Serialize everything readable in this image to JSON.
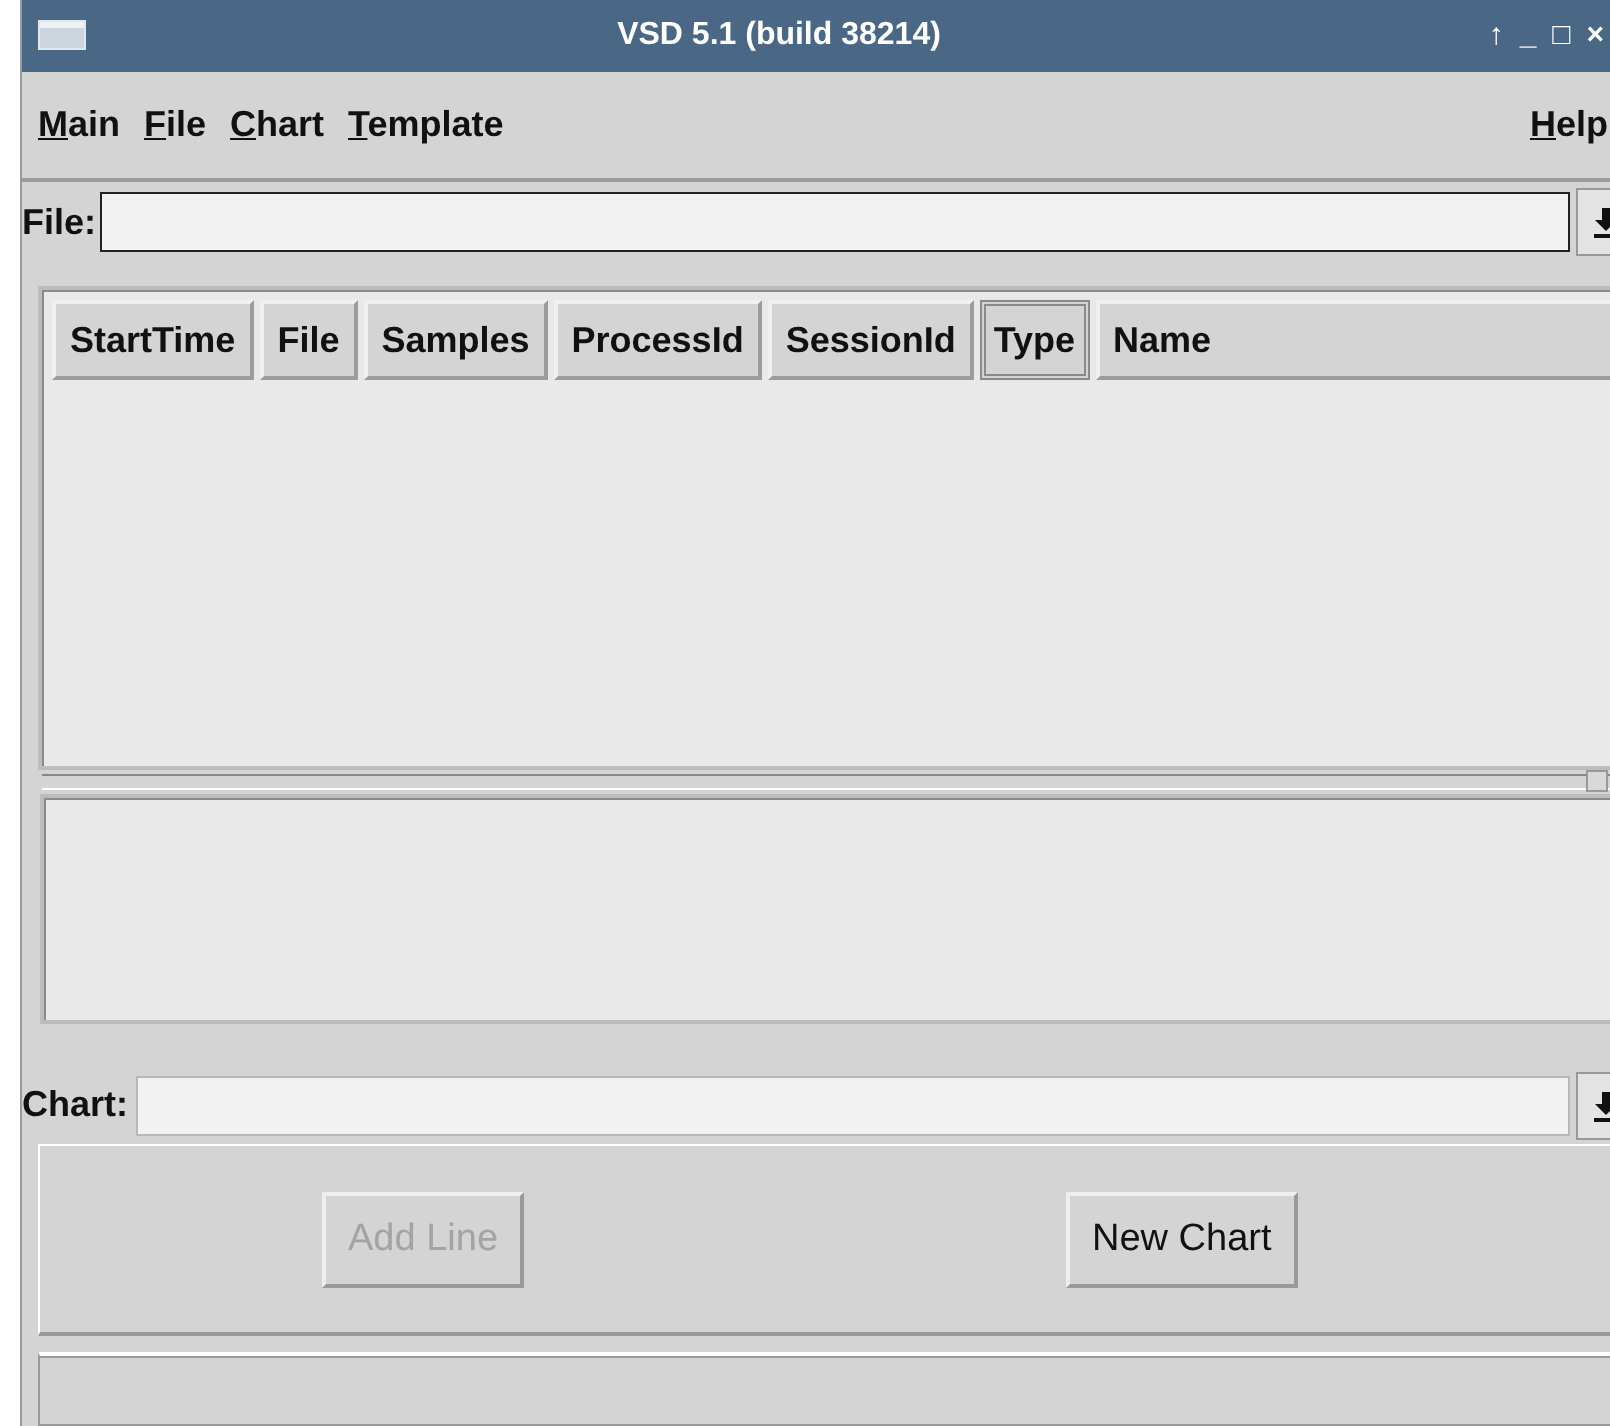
{
  "window": {
    "title": "VSD 5.1 (build 38214)",
    "controls": [
      "↑",
      "_",
      "□",
      "×"
    ]
  },
  "menu": [
    {
      "label": "Main"
    },
    {
      "label": "File"
    },
    {
      "label": "Chart"
    },
    {
      "label": "Template"
    },
    {
      "label": "Help",
      "kind": "right"
    }
  ],
  "file_row": {
    "label": "File:"
  },
  "table": {
    "columns": [
      {
        "label": "StartTime",
        "selected": false
      },
      {
        "label": "File",
        "selected": false
      },
      {
        "label": "Samples",
        "selected": false
      },
      {
        "label": "ProcessId",
        "selected": false
      },
      {
        "label": "SessionId",
        "selected": false
      },
      {
        "label": "Type",
        "selected": true
      },
      {
        "label": "Name",
        "selected": false
      }
    ]
  },
  "chart_row": {
    "label": "Chart:"
  },
  "buttons": [
    {
      "label": "Add Line",
      "disabled": true
    },
    {
      "label": "New Chart",
      "disabled": false
    }
  ]
}
